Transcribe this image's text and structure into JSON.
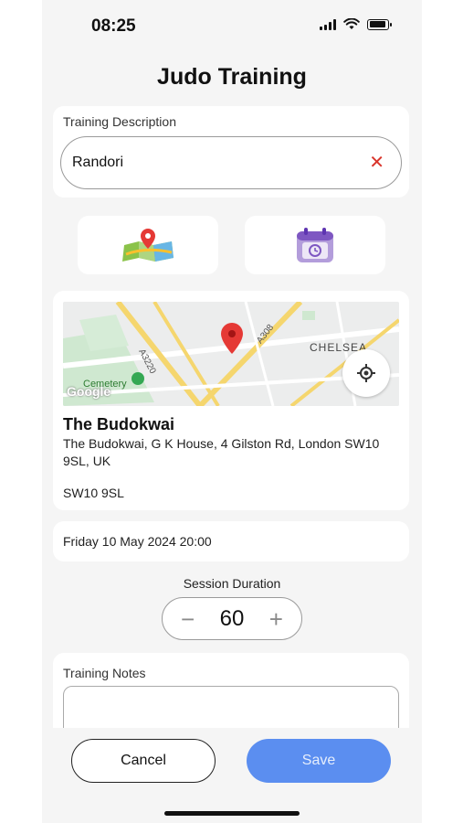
{
  "status_bar": {
    "time": "08:25"
  },
  "header": {
    "title": "Judo Training"
  },
  "description": {
    "label": "Training Description",
    "value": "Randori"
  },
  "location": {
    "map_labels": {
      "road1": "A3220",
      "road2": "A308",
      "area": "CHELSEA",
      "cemetery": "Cemetery",
      "brand": "Google"
    },
    "name": "The Budokwai",
    "address": "The Budokwai, G K House, 4 Gilston Rd, London SW10 9SL, UK",
    "postcode": "SW10 9SL"
  },
  "date": {
    "value": "Friday 10 May 2024 20:00"
  },
  "duration": {
    "label": "Session Duration",
    "value": "60",
    "minus": "−",
    "plus": "+"
  },
  "notes": {
    "label": "Training Notes",
    "value": ""
  },
  "actions": {
    "cancel_label": "Cancel",
    "save_label": "Save"
  },
  "icons": [
    "map-icon",
    "calendar-icon",
    "clear-icon",
    "locate-icon",
    "map-pin-icon"
  ],
  "colors": {
    "accent": "#5b8ef0",
    "clear": "#d9342b",
    "pin": "#e53935"
  }
}
